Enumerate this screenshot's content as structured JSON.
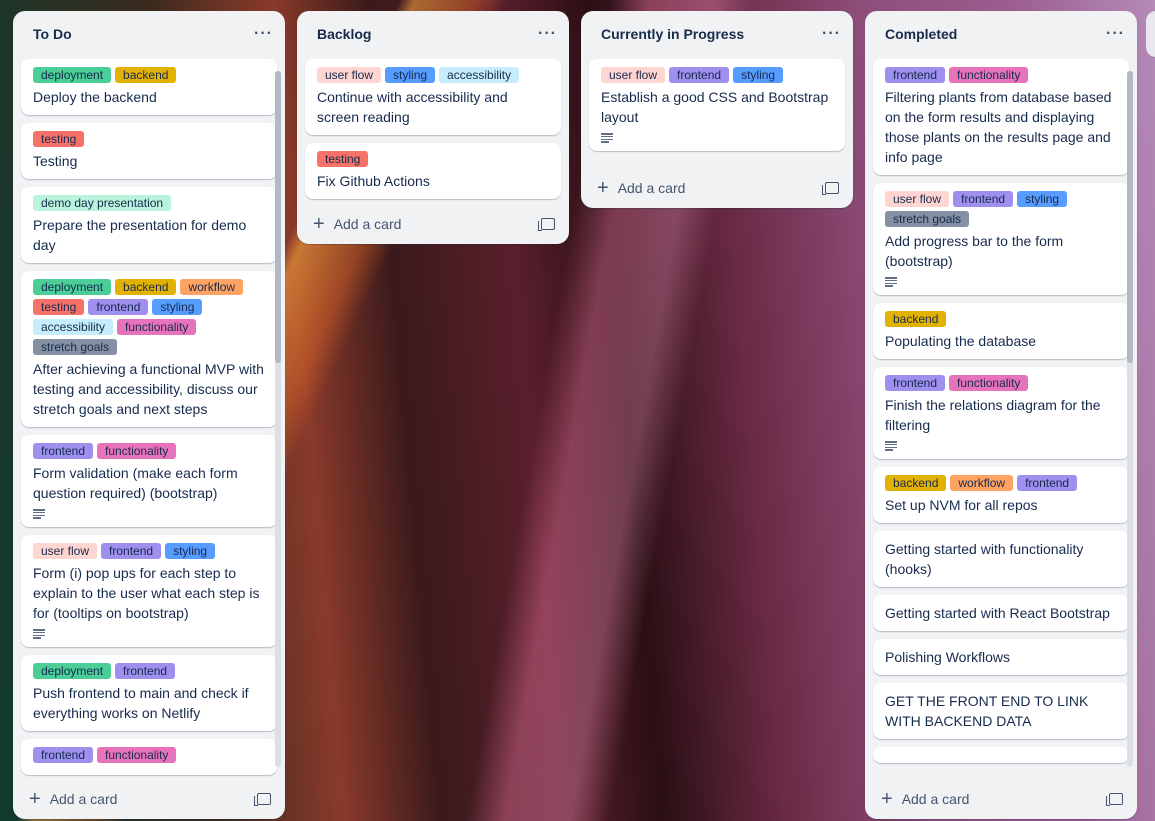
{
  "colors": {
    "deployment": "#4bce97",
    "backend": "#e2b203",
    "testing": "#f87168",
    "demo day presentation": "#baf3db",
    "workflow": "#fea362",
    "frontend": "#9f8fef",
    "styling": "#579dff",
    "accessibility": "#c6edfb",
    "functionality": "#e774bb",
    "stretch goals": "#8590a2",
    "user flow": "#ffd5d2"
  },
  "lists": [
    {
      "title": "To Do",
      "menu": "···",
      "add_card": "Add a card",
      "cards": [
        {
          "labels": [
            "deployment",
            "backend"
          ],
          "title": "Deploy the backend",
          "has_description": false
        },
        {
          "labels": [
            "testing"
          ],
          "title": "Testing",
          "has_description": false
        },
        {
          "labels": [
            "demo day presentation"
          ],
          "title": "Prepare the presentation for demo day",
          "has_description": false
        },
        {
          "labels": [
            "deployment",
            "backend",
            "workflow",
            "testing",
            "frontend",
            "styling",
            "accessibility",
            "functionality",
            "stretch goals"
          ],
          "title": "After achieving a functional MVP with testing and accessibility, discuss our stretch goals and next steps",
          "has_description": false
        },
        {
          "labels": [
            "frontend",
            "functionality"
          ],
          "title": "Form validation (make each form question required) (bootstrap)",
          "has_description": true
        },
        {
          "labels": [
            "user flow",
            "frontend",
            "styling"
          ],
          "title": "Form (i) pop ups for each step to explain to the user what each step is for (tooltips on bootstrap)",
          "has_description": true
        },
        {
          "labels": [
            "deployment",
            "frontend"
          ],
          "title": "Push frontend to main and check if everything works on Netlify",
          "has_description": false
        },
        {
          "labels": [
            "frontend",
            "functionality"
          ],
          "title": "",
          "has_description": false
        }
      ]
    },
    {
      "title": "Backlog",
      "menu": "···",
      "add_card": "Add a card",
      "cards": [
        {
          "labels": [
            "user flow",
            "styling",
            "accessibility"
          ],
          "title": "Continue with accessibility and screen reading",
          "has_description": false
        },
        {
          "labels": [
            "testing"
          ],
          "title": "Fix Github Actions",
          "has_description": false
        }
      ]
    },
    {
      "title": "Currently in Progress",
      "menu": "···",
      "add_card": "Add a card",
      "cards": [
        {
          "labels": [
            "user flow",
            "frontend",
            "styling"
          ],
          "title": "Establish a good CSS and Bootstrap layout",
          "has_description": true
        }
      ]
    },
    {
      "title": "Completed",
      "menu": "···",
      "add_card": "Add a card",
      "cards": [
        {
          "labels": [
            "frontend",
            "functionality"
          ],
          "title": "Filtering plants from database based on the form results and displaying those plants on the results page and info page",
          "has_description": false
        },
        {
          "labels": [
            "user flow",
            "frontend",
            "styling",
            "stretch goals"
          ],
          "title": "Add progress bar to the form (bootstrap)",
          "has_description": true
        },
        {
          "labels": [
            "backend"
          ],
          "title": "Populating the database",
          "has_description": false
        },
        {
          "labels": [
            "frontend",
            "functionality"
          ],
          "title": "Finish the relations diagram for the filtering",
          "has_description": true
        },
        {
          "labels": [
            "backend",
            "workflow",
            "frontend"
          ],
          "title": "Set up NVM for all repos",
          "has_description": false
        },
        {
          "labels": [],
          "title": "Getting started with functionality (hooks)",
          "has_description": false
        },
        {
          "labels": [],
          "title": "Getting started with React Bootstrap",
          "has_description": false
        },
        {
          "labels": [],
          "title": "Polishing Workflows",
          "has_description": false
        },
        {
          "labels": [],
          "title": "GET THE FRONT END TO LINK WITH BACKEND DATA",
          "has_description": false
        },
        {
          "labels": [],
          "title": "",
          "has_description": false
        }
      ]
    }
  ]
}
